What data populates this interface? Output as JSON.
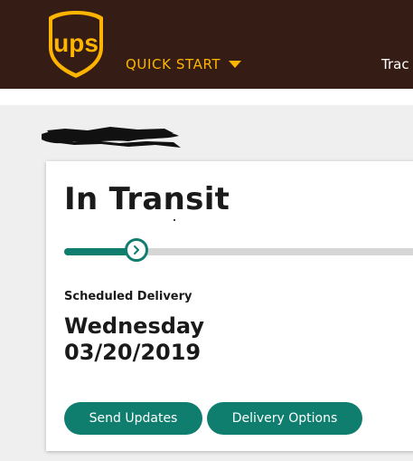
{
  "header": {
    "logo_text": "ups",
    "quick_start_label": "QUICK START",
    "nav_track_label": "Trac",
    "colors": {
      "background": "#351c15",
      "accent": "#ffb500"
    }
  },
  "status": {
    "title": "In Transit",
    "progress_fraction": 0.2
  },
  "delivery": {
    "label": "Scheduled Delivery",
    "day": "Wednesday",
    "date": "03/20/2019"
  },
  "actions": {
    "send_updates": "Send Updates",
    "delivery_options": "Delivery Options"
  },
  "icons": {
    "logo": "ups-shield-logo-icon",
    "quick_start_caret": "caret-down-icon",
    "progress_knob": "chevron-right-icon"
  },
  "colors": {
    "primary_button": "#0f7e6e",
    "progress_track": "#d6d6d6"
  }
}
